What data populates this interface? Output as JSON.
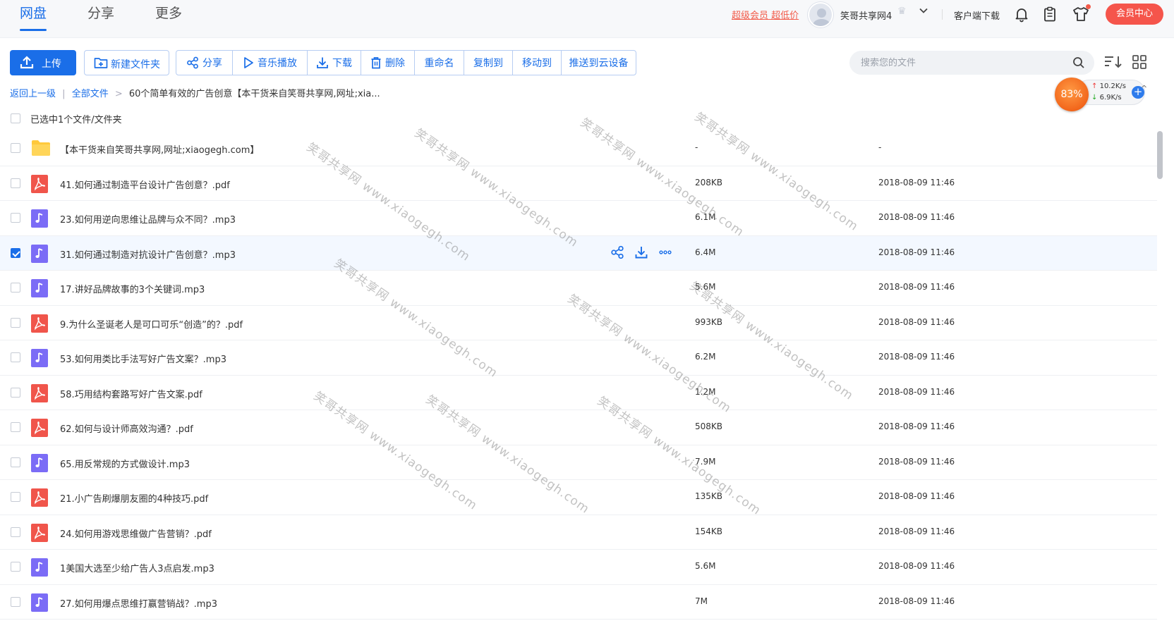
{
  "nav": {
    "tabs": [
      "网盘",
      "分享",
      "更多"
    ],
    "promo": "超级会员 超低价",
    "username": "笑哥共享网4",
    "client_download": "客户端下载",
    "vip_center": "会员中心"
  },
  "toolbar": {
    "upload": "上传",
    "new_folder": "新建文件夹",
    "share": "分享",
    "music": "音乐播放",
    "download": "下载",
    "delete": "删除",
    "rename": "重命名",
    "copy_to": "复制到",
    "move_to": "移动到",
    "push": "推送到云设备"
  },
  "search": {
    "placeholder": "搜索您的文件"
  },
  "breadcrumb": {
    "back": "返回上一级",
    "all_files": "全部文件",
    "current": "60个简单有效的广告创意【本干货来自笑哥共享网,网址;xia..."
  },
  "speed": {
    "percent": "83%",
    "up": "10.2K/s",
    "down": "6.9K/s"
  },
  "selection_text": "已选中1个文件/文件夹",
  "watermark": "笑哥共享网 www.xiaogegh.com",
  "files": [
    {
      "name": "【本干货来自笑哥共享网,网址;xiaogegh.com】",
      "type": "folder",
      "size": "-",
      "date": "-",
      "checked": false
    },
    {
      "name": "41.如何通过制造平台设计广告创意？.pdf",
      "type": "pdf",
      "size": "208KB",
      "date": "2018-08-09 11:46",
      "checked": false
    },
    {
      "name": "23.如何用逆向思维让品牌与众不同？.mp3",
      "type": "mp3",
      "size": "6.1M",
      "date": "2018-08-09 11:46",
      "checked": false
    },
    {
      "name": "31.如何通过制造对抗设计广告创意？.mp3",
      "type": "mp3",
      "size": "6.4M",
      "date": "2018-08-09 11:46",
      "checked": true
    },
    {
      "name": "17.讲好品牌故事的3个关键词.mp3",
      "type": "mp3",
      "size": "5.6M",
      "date": "2018-08-09 11:46",
      "checked": false
    },
    {
      "name": "9.为什么圣诞老人是可口可乐“创造”的？.pdf",
      "type": "pdf",
      "size": "993KB",
      "date": "2018-08-09 11:46",
      "checked": false
    },
    {
      "name": "53.如何用类比手法写好广告文案？.mp3",
      "type": "mp3",
      "size": "6.2M",
      "date": "2018-08-09 11:46",
      "checked": false
    },
    {
      "name": "58.巧用结构套路写好广告文案.pdf",
      "type": "pdf",
      "size": "1.2M",
      "date": "2018-08-09 11:46",
      "checked": false
    },
    {
      "name": "62.如何与设计师高效沟通？.pdf",
      "type": "pdf",
      "size": "508KB",
      "date": "2018-08-09 11:46",
      "checked": false
    },
    {
      "name": "65.用反常规的方式做设计.mp3",
      "type": "mp3",
      "size": "7.9M",
      "date": "2018-08-09 11:46",
      "checked": false
    },
    {
      "name": "21.小广告刷爆朋友圈的4种技巧.pdf",
      "type": "pdf",
      "size": "135KB",
      "date": "2018-08-09 11:46",
      "checked": false
    },
    {
      "name": "24.如何用游戏思维做广告营销？.pdf",
      "type": "pdf",
      "size": "154KB",
      "date": "2018-08-09 11:46",
      "checked": false
    },
    {
      "name": "1美国大选至少给广告人3点启发.mp3",
      "type": "mp3",
      "size": "5.6M",
      "date": "2018-08-09 11:46",
      "checked": false
    },
    {
      "name": "27.如何用爆点思维打赢营销战？.mp3",
      "type": "mp3",
      "size": "7M",
      "date": "2018-08-09 11:46",
      "checked": false
    }
  ],
  "colors": {
    "accent": "#1a6ee8",
    "pdf": "#f0554b",
    "mp3": "#7b6cf6",
    "folder": "#ffc93c",
    "vip": "#f5554b"
  }
}
